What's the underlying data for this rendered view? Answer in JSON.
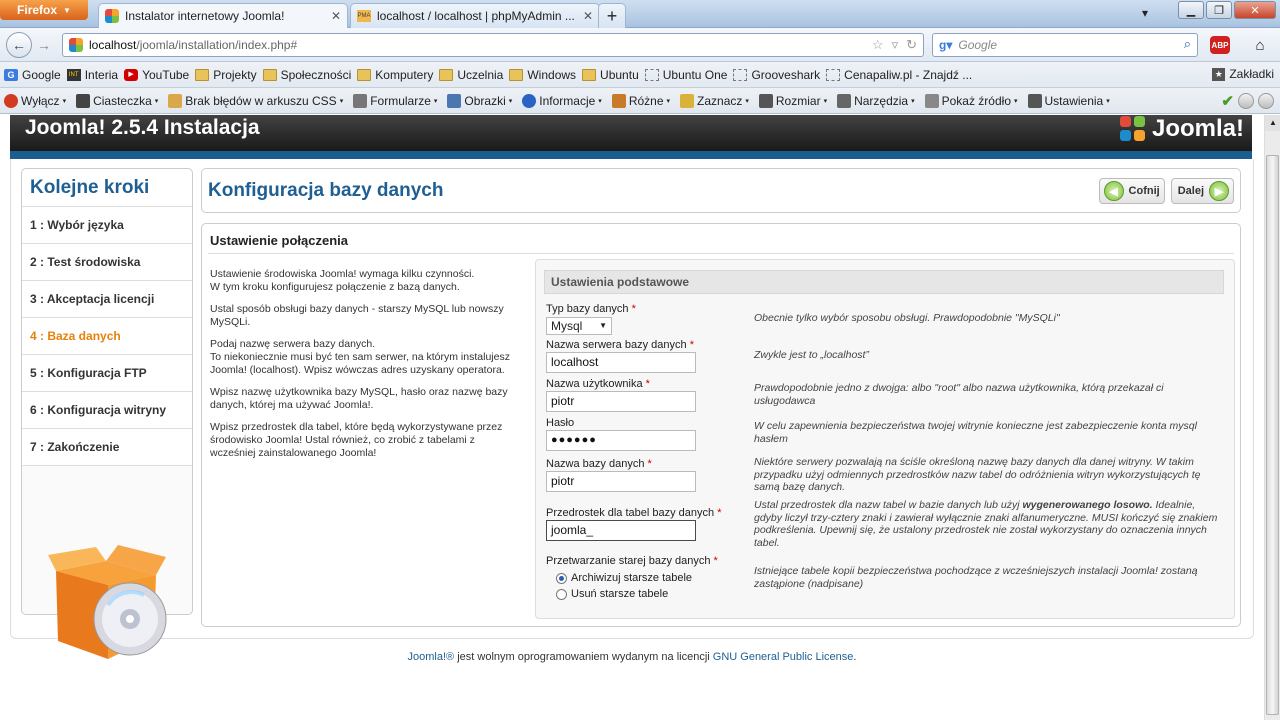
{
  "browser": {
    "app_button": "Firefox",
    "tabs": [
      {
        "label": "Instalator internetowy Joomla!",
        "active": true
      },
      {
        "label": "localhost / localhost | phpMyAdmin ...",
        "active": false
      }
    ],
    "new_tab": "+",
    "url_host": "localhost",
    "url_path": "/joomla/installation/index.php#",
    "search_engine": "Google",
    "search_placeholder": "Google",
    "abp_label": "ABP"
  },
  "bookmarks": [
    {
      "label": "Google",
      "icon": "google-icon"
    },
    {
      "label": "Interia",
      "icon": "interia-icon"
    },
    {
      "label": "YouTube",
      "icon": "youtube-icon"
    },
    {
      "label": "Projekty",
      "icon": "folder-icon"
    },
    {
      "label": "Społeczności",
      "icon": "folder-icon"
    },
    {
      "label": "Komputery",
      "icon": "folder-icon"
    },
    {
      "label": "Uczelnia",
      "icon": "folder-icon"
    },
    {
      "label": "Windows",
      "icon": "folder-icon"
    },
    {
      "label": "Ubuntu",
      "icon": "folder-icon"
    },
    {
      "label": "Ubuntu One",
      "icon": "page-icon"
    },
    {
      "label": "Grooveshark",
      "icon": "page-icon"
    },
    {
      "label": "Cenapaliw.pl - Znajdź ...",
      "icon": "page-icon"
    }
  ],
  "bookmarks_menu": "Zakładki",
  "devbar": [
    {
      "label": "Wyłącz",
      "icon": "disable-icon"
    },
    {
      "label": "Ciasteczka",
      "icon": "cookie-icon"
    },
    {
      "label": "Brak błędów w arkuszu CSS",
      "icon": "pencil-icon"
    },
    {
      "label": "Formularze",
      "icon": "form-icon"
    },
    {
      "label": "Obrazki",
      "icon": "image-icon"
    },
    {
      "label": "Informacje",
      "icon": "info-icon"
    },
    {
      "label": "Różne",
      "icon": "misc-icon"
    },
    {
      "label": "Zaznacz",
      "icon": "highlight-icon"
    },
    {
      "label": "Rozmiar",
      "icon": "resize-icon"
    },
    {
      "label": "Narzędzia",
      "icon": "tools-icon"
    },
    {
      "label": "Pokaż źródło",
      "icon": "source-icon"
    },
    {
      "label": "Ustawienia",
      "icon": "settings-icon"
    }
  ],
  "joomla": {
    "header_title": "Joomla! 2.5.4 Instalacja",
    "logo_text": "Joomla!",
    "steps_title": "Kolejne kroki",
    "steps": [
      {
        "label": "1 : Wybór języka",
        "active": false
      },
      {
        "label": "2 : Test środowiska",
        "active": false
      },
      {
        "label": "3 : Akceptacja licencji",
        "active": false
      },
      {
        "label": "4 : Baza danych",
        "active": true
      },
      {
        "label": "5 : Konfiguracja FTP",
        "active": false
      },
      {
        "label": "6 : Konfiguracja witryny",
        "active": false
      },
      {
        "label": "7 : Zakończenie",
        "active": false
      }
    ],
    "page_title": "Konfiguracja bazy danych",
    "back_label": "Cofnij",
    "next_label": "Dalej",
    "section_title": "Ustawienie połączenia",
    "help": [
      "Ustawienie środowiska Joomla! wymaga kilku czynności.\nW tym kroku konfigurujesz połączenie z bazą danych.",
      "Ustal sposób obsługi bazy danych - starszy MySQL lub nowszy MySQLi.",
      "Podaj nazwę serwera bazy danych.\nTo niekoniecznie musi być ten sam serwer, na którym instalujesz Joomla! (localhost). Wpisz wówczas adres uzyskany operatora.",
      "Wpisz nazwę użytkownika bazy MySQL, hasło oraz nazwę bazy danych, której ma używać Joomla!.",
      "Wpisz przedrostek dla tabel, które będą wykorzystywane przez środowisko Joomla! Ustal również, co zrobić z tabelami z wcześniej zainstalowanego Joomla!"
    ],
    "form_box_title": "Ustawienia podstawowe",
    "fields": {
      "db_type": {
        "label": "Typ bazy danych",
        "value": "Mysql",
        "note": "Obecnie tylko wybór sposobu obsługi. Prawdopodobnie \"MySQLi\""
      },
      "host": {
        "label": "Nazwa serwera bazy danych",
        "value": "localhost",
        "note": "Zwykle jest to „localhost”"
      },
      "user": {
        "label": "Nazwa użytkownika",
        "value": "piotr",
        "note": "Prawdopodobnie jedno z dwojga: albo \"root\" albo nazwa użytkownika, którą przekazał ci usługodawca"
      },
      "password": {
        "label": "Hasło",
        "value": "●●●●●●",
        "note": "W celu zapewnienia bezpieczeństwa twojej witrynie konieczne jest zabezpieczenie konta mysql hasłem"
      },
      "dbname": {
        "label": "Nazwa bazy danych",
        "value": "piotr",
        "note": "Niektóre serwery pozwalają na ściśle określoną nazwę bazy danych dla danej witryny. W takim przypadku użyj odmiennych przedrostków nazw tabel do odróżnienia witryn wykorzystujących tę samą bazę danych."
      },
      "prefix": {
        "label": "Przedrostek dla tabel bazy danych",
        "value": "joomla_",
        "note_pre": "Ustal przedrostek dla nazw tabel w bazie danych lub użyj ",
        "note_bold": "wygenerowanego losowo.",
        "note_post": " Idealnie, gdyby liczył trzy-cztery znaki i zawierał wyłącznie znaki alfanumeryczne. MUSI kończyć się znakiem podkreślenia. Upewnij się, że ustalony przedrostek nie został wykorzystany do oznaczenia innych tabel."
      },
      "old_db": {
        "label": "Przetwarzanie starej bazy danych",
        "option_backup": "Archiwizuj starsze tabele",
        "option_remove": "Usuń starsze tabele",
        "selected": "backup",
        "note": "Istniejące tabele kopii bezpieczeństwa pochodzące z wcześniejszych instalacji Joomla! zostaną zastąpione (nadpisane)"
      }
    },
    "required_mark": "*",
    "footer_link1": "Joomla!®",
    "footer_text": " jest wolnym oprogramowaniem wydanym na licencji ",
    "footer_link2": "GNU General Public License",
    "footer_end": "."
  },
  "colors": {
    "accent": "#1f5f92",
    "active_step": "#e8810b",
    "required": "#cc0000"
  }
}
